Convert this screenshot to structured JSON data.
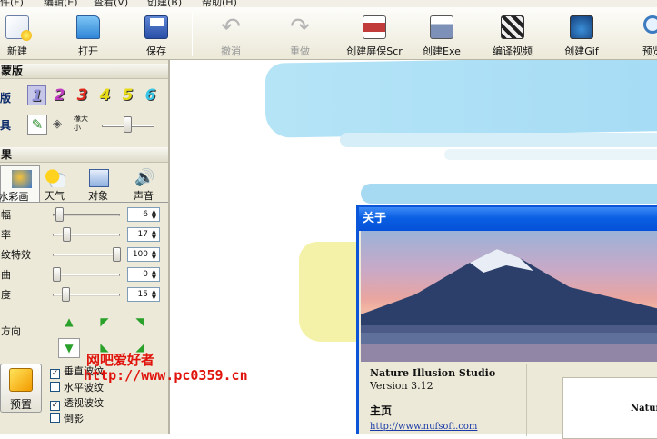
{
  "menu": [
    "件(F)",
    "编辑(E)",
    "查看(V)",
    "创建(B)",
    "帮助(H)"
  ],
  "toolbar": {
    "new": "新建",
    "open": "打开",
    "save": "保存",
    "undo": "撤消",
    "redo": "重做",
    "screensaver": "创建屏保Scr",
    "exe": "创建Exe",
    "video": "编译视频",
    "gif": "创建Gif",
    "preview": "预览"
  },
  "panel": {
    "mask_header": "蒙版",
    "layers_label": "版",
    "layer_numbers": [
      "1",
      "2",
      "3",
      "4",
      "5",
      "6"
    ],
    "tools_label": "具",
    "eraser_size_label": "橡大小",
    "effects_header": "果",
    "tabs": [
      "水彩画",
      "天气",
      "对象",
      "声音"
    ],
    "sliders": [
      {
        "label": "幅",
        "value": "6",
        "level": 0.05
      },
      {
        "label": "率",
        "value": "17",
        "level": 0.17
      },
      {
        "label": "纹特效",
        "value": "100",
        "level": 1.0
      },
      {
        "label": "曲",
        "value": "0",
        "level": 0.0
      },
      {
        "label": "度",
        "value": "15",
        "level": 0.15
      }
    ],
    "direction_label": "方向",
    "preset": "预置",
    "checks": [
      {
        "label": "垂直波纹",
        "checked": true
      },
      {
        "label": "水平波纹",
        "checked": false
      },
      {
        "label": "透视波纹",
        "checked": true
      },
      {
        "label": "倒影",
        "checked": false
      }
    ]
  },
  "dialog": {
    "title": "关于",
    "app_name": "Nature Illusion Studio",
    "version": "Version 3.12",
    "homepage_label": "主页",
    "homepage_url": "http://www.nufsoft.com",
    "box_text": "Natur"
  },
  "watermark": {
    "line1": "网吧爱好者",
    "line2": "http://www.pc0359.cn"
  },
  "colors": {
    "title_blue": "#0a5fe3",
    "panel_bg": "#ece9d8",
    "watermark": "#e0140c"
  }
}
